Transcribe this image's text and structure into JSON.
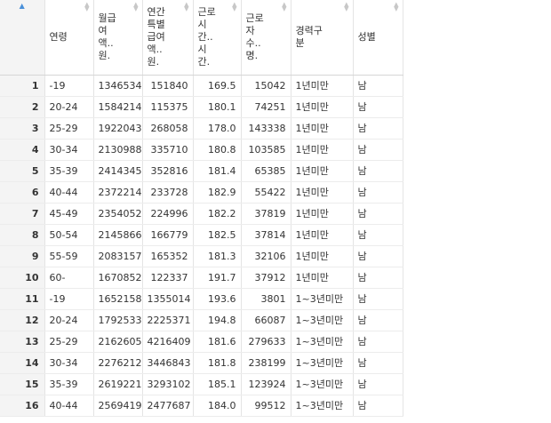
{
  "table": {
    "columns": [
      {
        "label": "",
        "align": "right"
      },
      {
        "label": "연령",
        "align": "left"
      },
      {
        "label": "월급\n여\n액..\n원.",
        "align": "right"
      },
      {
        "label": "연간\n특별\n급여\n액..\n원.",
        "align": "right"
      },
      {
        "label": "근로\n시\n간..\n시\n간.",
        "align": "right"
      },
      {
        "label": "근로\n자\n수..\n명.",
        "align": "right"
      },
      {
        "label": "경력구\n분",
        "align": "left"
      },
      {
        "label": "성별",
        "align": "left"
      }
    ],
    "rows": [
      [
        "1",
        "-19",
        "1346534",
        "151840",
        "169.5",
        "15042",
        "1년미만",
        "남"
      ],
      [
        "2",
        "20-24",
        "1584214",
        "115375",
        "180.1",
        "74251",
        "1년미만",
        "남"
      ],
      [
        "3",
        "25-29",
        "1922043",
        "268058",
        "178.0",
        "143338",
        "1년미만",
        "남"
      ],
      [
        "4",
        "30-34",
        "2130988",
        "335710",
        "180.8",
        "103585",
        "1년미만",
        "남"
      ],
      [
        "5",
        "35-39",
        "2414345",
        "352816",
        "181.4",
        "65385",
        "1년미만",
        "남"
      ],
      [
        "6",
        "40-44",
        "2372214",
        "233728",
        "182.9",
        "55422",
        "1년미만",
        "남"
      ],
      [
        "7",
        "45-49",
        "2354052",
        "224996",
        "182.2",
        "37819",
        "1년미만",
        "남"
      ],
      [
        "8",
        "50-54",
        "2145866",
        "166779",
        "182.5",
        "37814",
        "1년미만",
        "남"
      ],
      [
        "9",
        "55-59",
        "2083157",
        "165352",
        "181.3",
        "32106",
        "1년미만",
        "남"
      ],
      [
        "10",
        "60-",
        "1670852",
        "122337",
        "191.7",
        "37912",
        "1년미만",
        "남"
      ],
      [
        "11",
        "-19",
        "1652158",
        "1355014",
        "193.6",
        "3801",
        "1~3년미만",
        "남"
      ],
      [
        "12",
        "20-24",
        "1792533",
        "2225371",
        "194.8",
        "66087",
        "1~3년미만",
        "남"
      ],
      [
        "13",
        "25-29",
        "2162605",
        "4216409",
        "181.6",
        "279633",
        "1~3년미만",
        "남"
      ],
      [
        "14",
        "30-34",
        "2276212",
        "3446843",
        "181.8",
        "238199",
        "1~3년미만",
        "남"
      ],
      [
        "15",
        "35-39",
        "2619221",
        "3293102",
        "185.1",
        "123924",
        "1~3년미만",
        "남"
      ],
      [
        "16",
        "40-44",
        "2569419",
        "2477687",
        "184.0",
        "99512",
        "1~3년미만",
        "남"
      ]
    ]
  }
}
